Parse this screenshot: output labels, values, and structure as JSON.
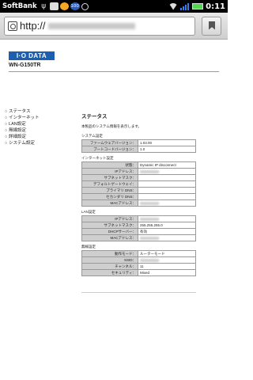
{
  "status_bar": {
    "carrier": "SoftBank",
    "badge": "100",
    "time": "0:11"
  },
  "browser": {
    "url_prefix": "http://",
    "url_blurred": "192.168.0.1/index.asp"
  },
  "header": {
    "logo": "I·O DATA",
    "model": "WN-G150TR"
  },
  "nav": {
    "items": [
      {
        "label": "ステータス"
      },
      {
        "label": "インターネット"
      },
      {
        "label": "LAN設定"
      },
      {
        "label": "無線設定"
      },
      {
        "label": "詳細設定"
      },
      {
        "label": "システム設定"
      }
    ]
  },
  "main": {
    "title": "ステータス",
    "description": "本製品のシステム情報を表示します。",
    "sections": [
      {
        "title": "システム設定",
        "rows": [
          {
            "key": "ファームウェアバージョン：",
            "value": "1.03.00"
          },
          {
            "key": "ブートコードバージョン：",
            "value": "1.0"
          }
        ]
      },
      {
        "title": "インターネット設定",
        "rows": [
          {
            "key": "状態：",
            "value": "Dynamic IP disconnect"
          },
          {
            "key": "IPアドレス：",
            "value": ""
          },
          {
            "key": "サブネットマスク：",
            "value": ""
          },
          {
            "key": "デフォルトゲートウェイ：",
            "value": ""
          },
          {
            "key": "プライマリ DNS：",
            "value": ""
          },
          {
            "key": "セカンダリ DNS：",
            "value": ""
          },
          {
            "key": "MACアドレス：",
            "value": ""
          }
        ]
      },
      {
        "title": "LAN設定",
        "rows": [
          {
            "key": "IPアドレス：",
            "value": ""
          },
          {
            "key": "サブネットマスク：",
            "value": "255.255.255.0"
          },
          {
            "key": "DHCPサーバー：",
            "value": "有効"
          },
          {
            "key": "MACアドレス：",
            "value": ""
          }
        ]
      },
      {
        "title": "無線設定",
        "rows": [
          {
            "key": "動作モード：",
            "value": "ルーターモード"
          },
          {
            "key": "SSID：",
            "value": ""
          },
          {
            "key": "チャンネル：",
            "value": "11"
          },
          {
            "key": "セキュリティ：",
            "value": "Mixed"
          }
        ]
      }
    ]
  }
}
